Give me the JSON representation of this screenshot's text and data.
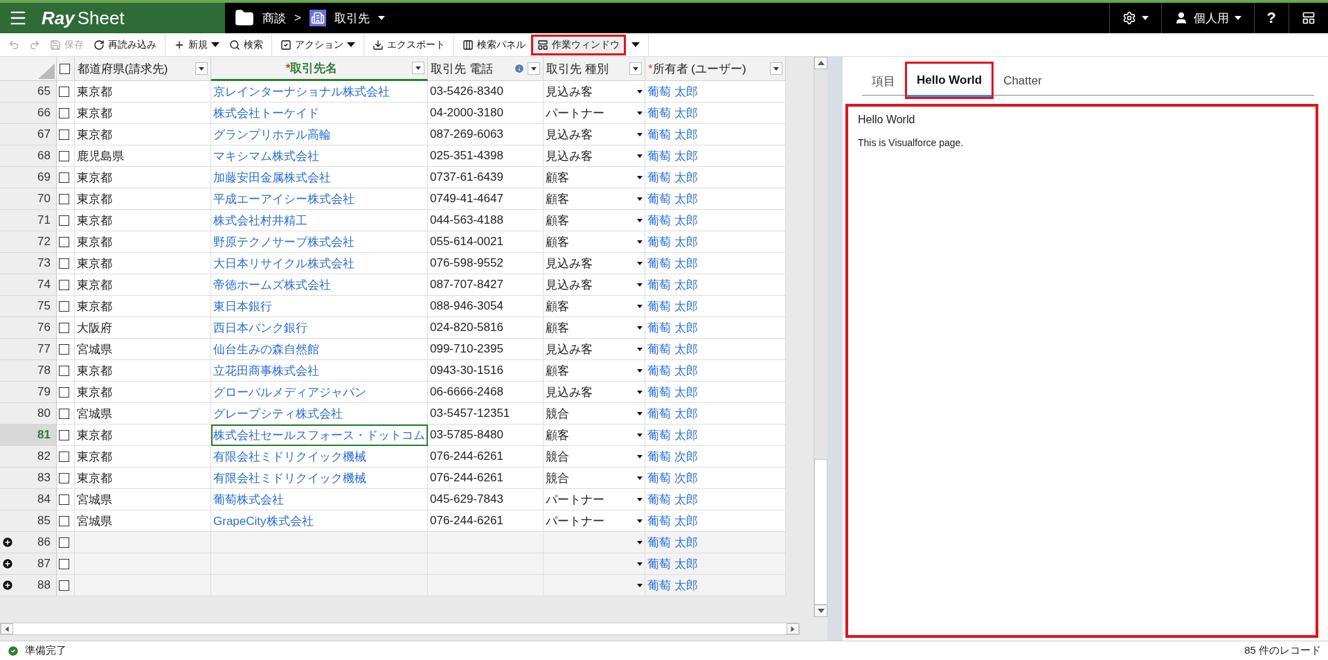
{
  "topbar": {
    "logo_bold": "Ray",
    "logo_rest": "Sheet",
    "breadcrumb": [
      {
        "label": "商談",
        "dropdown": false
      },
      {
        "label": "取引先",
        "dropdown": true
      }
    ],
    "separator": ">",
    "user": "個人用",
    "help": "?"
  },
  "toolbar": {
    "groups": [
      [
        {
          "disabled": true
        },
        {
          "disabled": true
        },
        {
          "label": "保存",
          "disabled": true
        },
        {
          "label": "再読み込み",
          "disabled": false
        }
      ],
      [
        {
          "label": "新規",
          "disabled": false,
          "dropdown": true
        },
        {
          "label": "検索",
          "disabled": false,
          "dropdown": false
        }
      ],
      [
        {
          "label": "アクション",
          "disabled": false,
          "dropdown": true
        }
      ],
      [
        {
          "label": "エクスポート",
          "disabled": false
        }
      ],
      [
        {
          "label": "検索パネル",
          "disabled": false,
          "highlighted": false
        },
        {
          "label": "作業ウィンドウ",
          "disabled": false,
          "highlighted": true
        }
      ]
    ]
  },
  "table": {
    "select_all_checked": false,
    "columns": [
      {
        "label": "都道府県(請求先)",
        "info": false,
        "selected": false
      },
      {
        "label": "取引先名",
        "required_mark": "*",
        "info": false,
        "selected": true
      },
      {
        "label": "取引先 電話",
        "info": true,
        "selected": false
      },
      {
        "label": "取引先 種別",
        "info": false,
        "selected": false
      },
      {
        "label": "所有者 (ユーザー)",
        "required_mark": "*",
        "info": false,
        "selected": false
      }
    ],
    "rows": [
      {
        "number": "65",
        "kind": "record",
        "checked": false,
        "selected": false,
        "prefecture": "東京都",
        "name": "京レインターナショナル株式会社",
        "phone": "03-5426-8340",
        "type": "見込み客",
        "owner": "葡萄 太郎"
      },
      {
        "number": "66",
        "kind": "record",
        "checked": false,
        "selected": false,
        "prefecture": "東京都",
        "name": "株式会社トーケイド",
        "phone": "04-2000-3180",
        "type": "パートナー",
        "owner": "葡萄 太郎"
      },
      {
        "number": "67",
        "kind": "record",
        "checked": false,
        "selected": false,
        "prefecture": "東京都",
        "name": "グランプリホテル高輪",
        "phone": "087-269-6063",
        "type": "見込み客",
        "owner": "葡萄 太郎"
      },
      {
        "number": "68",
        "kind": "record",
        "checked": false,
        "selected": false,
        "prefecture": "鹿児島県",
        "name": "マキシマム株式会社",
        "phone": "025-351-4398",
        "type": "見込み客",
        "owner": "葡萄 太郎"
      },
      {
        "number": "69",
        "kind": "record",
        "checked": false,
        "selected": false,
        "prefecture": "東京都",
        "name": "加藤安田金属株式会社",
        "phone": "0737-61-6439",
        "type": "顧客",
        "owner": "葡萄 太郎"
      },
      {
        "number": "70",
        "kind": "record",
        "checked": false,
        "selected": false,
        "prefecture": "東京都",
        "name": "平成エーアイシー株式会社",
        "phone": "0749-41-4647",
        "type": "顧客",
        "owner": "葡萄 太郎"
      },
      {
        "number": "71",
        "kind": "record",
        "checked": false,
        "selected": false,
        "prefecture": "東京都",
        "name": "株式会社村井精工",
        "phone": "044-563-4188",
        "type": "顧客",
        "owner": "葡萄 太郎"
      },
      {
        "number": "72",
        "kind": "record",
        "checked": false,
        "selected": false,
        "prefecture": "東京都",
        "name": "野原テクノサーブ株式会社",
        "phone": "055-614-0021",
        "type": "顧客",
        "owner": "葡萄 太郎"
      },
      {
        "number": "73",
        "kind": "record",
        "checked": false,
        "selected": false,
        "prefecture": "東京都",
        "name": "大日本リサイクル株式会社",
        "phone": "076-598-9552",
        "type": "見込み客",
        "owner": "葡萄 太郎"
      },
      {
        "number": "74",
        "kind": "record",
        "checked": false,
        "selected": false,
        "prefecture": "東京都",
        "name": "帝徳ホームズ株式会社",
        "phone": "087-707-8427",
        "type": "見込み客",
        "owner": "葡萄 太郎"
      },
      {
        "number": "75",
        "kind": "record",
        "checked": false,
        "selected": false,
        "prefecture": "東京都",
        "name": "東日本銀行",
        "phone": "088-946-3054",
        "type": "顧客",
        "owner": "葡萄 太郎"
      },
      {
        "number": "76",
        "kind": "record",
        "checked": false,
        "selected": false,
        "prefecture": "大阪府",
        "name": "西日本バンク銀行",
        "phone": "024-820-5816",
        "type": "顧客",
        "owner": "葡萄 太郎"
      },
      {
        "number": "77",
        "kind": "record",
        "checked": false,
        "selected": false,
        "prefecture": "宮城県",
        "name": "仙台生みの森自然館",
        "phone": "099-710-2395",
        "type": "見込み客",
        "owner": "葡萄 太郎"
      },
      {
        "number": "78",
        "kind": "record",
        "checked": false,
        "selected": false,
        "prefecture": "東京都",
        "name": "立花田商事株式会社",
        "phone": "0943-30-1516",
        "type": "顧客",
        "owner": "葡萄 太郎"
      },
      {
        "number": "79",
        "kind": "record",
        "checked": false,
        "selected": false,
        "prefecture": "東京都",
        "name": "グローバルメディアジャパン",
        "phone": "06-6666-2468",
        "type": "見込み客",
        "owner": "葡萄 太郎"
      },
      {
        "number": "80",
        "kind": "record",
        "checked": false,
        "selected": false,
        "prefecture": "宮城県",
        "name": "グレープシティ株式会社",
        "phone": "03-5457-12351",
        "type": "競合",
        "owner": "葡萄 太郎"
      },
      {
        "number": "81",
        "kind": "record",
        "checked": false,
        "selected": true,
        "prefecture": "東京都",
        "name": "株式会社セールスフォース・ドットコム",
        "phone": "03-5785-8480",
        "type": "顧客",
        "owner": "葡萄 太郎"
      },
      {
        "number": "82",
        "kind": "record",
        "checked": false,
        "selected": false,
        "prefecture": "東京都",
        "name": "有限会社ミドリクイック機械",
        "phone": "076-244-6261",
        "type": "競合",
        "owner": "葡萄 次郎"
      },
      {
        "number": "83",
        "kind": "record",
        "checked": false,
        "selected": false,
        "prefecture": "東京都",
        "name": "有限会社ミドリクイック機械",
        "phone": "076-244-6261",
        "type": "競合",
        "owner": "葡萄 次郎"
      },
      {
        "number": "84",
        "kind": "record",
        "checked": false,
        "selected": false,
        "prefecture": "宮城県",
        "name": "葡萄株式会社",
        "phone": "045-629-7843",
        "type": "パートナー",
        "owner": "葡萄 太郎"
      },
      {
        "number": "85",
        "kind": "record",
        "checked": false,
        "selected": false,
        "prefecture": "宮城県",
        "name": "GrapeCity株式会社",
        "phone": "076-244-6261",
        "type": "パートナー",
        "owner": "葡萄 太郎"
      },
      {
        "number": "86",
        "kind": "new",
        "checked": false,
        "selected": false,
        "owner": "葡萄 太郎"
      },
      {
        "number": "87",
        "kind": "new",
        "checked": false,
        "selected": false,
        "owner": "葡萄 太郎"
      },
      {
        "number": "88",
        "kind": "new",
        "checked": false,
        "selected": false,
        "owner": "葡萄 太郎"
      }
    ]
  },
  "side_panel": {
    "tabs": [
      {
        "label": "項目",
        "selected": false,
        "highlighted": false
      },
      {
        "label": "Hello World",
        "selected": true,
        "highlighted": true
      },
      {
        "label": "Chatter",
        "selected": false,
        "highlighted": false
      }
    ],
    "content": {
      "title": "Hello World",
      "body": "This is Visualforce page.",
      "highlighted": true
    }
  },
  "status_bar": {
    "text": "準備完了",
    "record_count": "85 件のレコード"
  }
}
